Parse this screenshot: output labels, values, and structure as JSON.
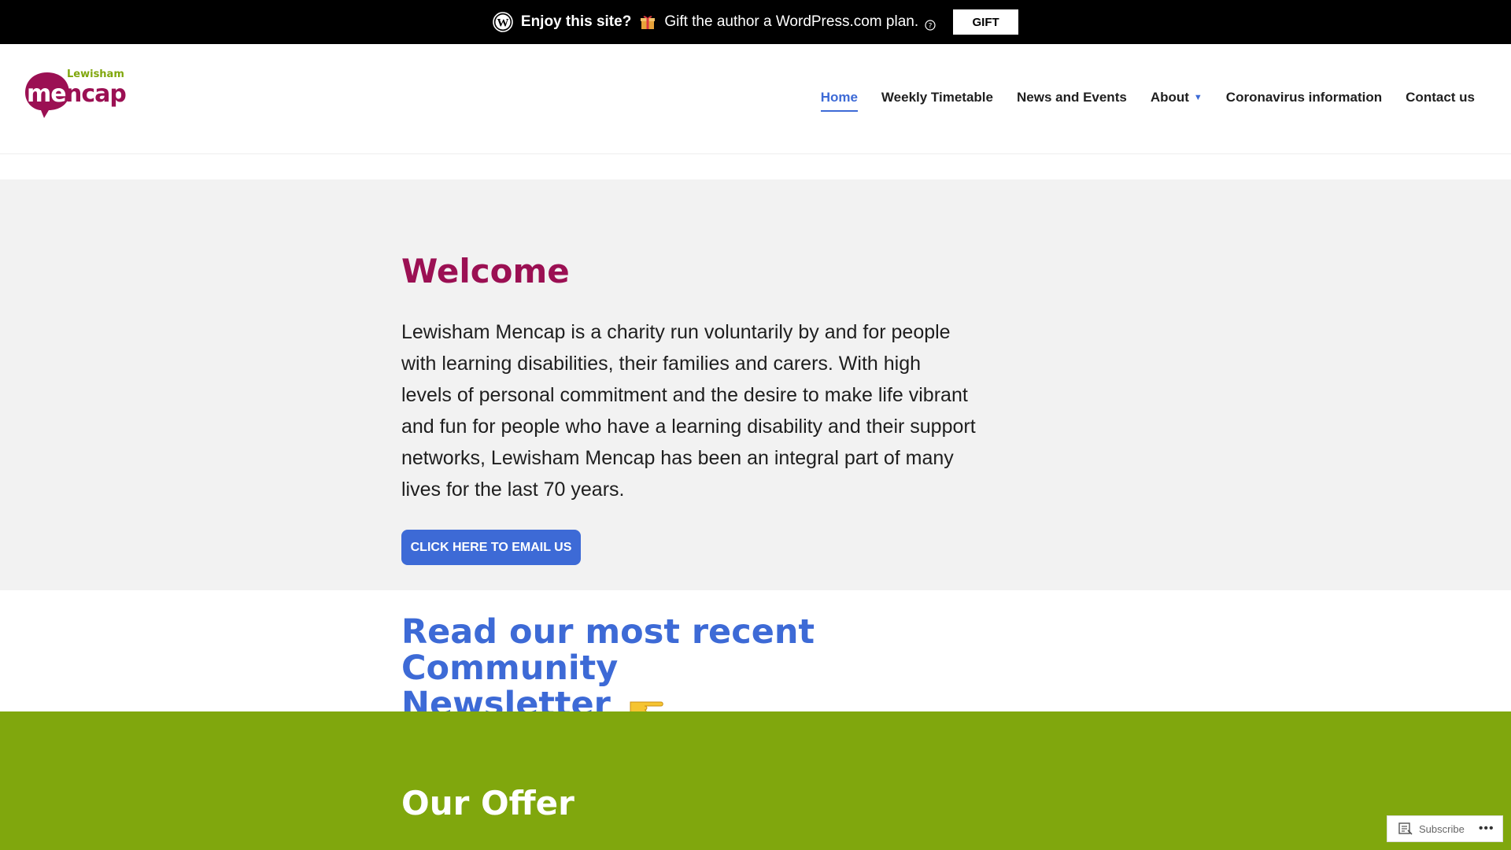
{
  "promo": {
    "enjoy_text": "Enjoy this site?",
    "message": "Gift the author a WordPress.com plan.",
    "gift_button": "GIFT"
  },
  "logo": {
    "small_text": "Lewisham",
    "main_text": "mencap",
    "brand_color": "#9b1053",
    "accent_color": "#80a70d"
  },
  "nav": {
    "items": [
      {
        "label": "Home",
        "active": true
      },
      {
        "label": "Weekly Timetable"
      },
      {
        "label": "News and Events"
      },
      {
        "label": "About",
        "has_dropdown": true
      },
      {
        "label": "Coronavirus information"
      },
      {
        "label": "Contact us"
      }
    ]
  },
  "welcome": {
    "title": "Welcome",
    "body": "Lewisham Mencap is a charity run voluntarily by and for people with learning disabilities, their families and carers.  With high levels of personal commitment and the desire to make life vibrant and fun for people who have a learning disability and their support networks, Lewisham Mencap has been an integral part of many lives for the last 70 years.",
    "button": "CLICK HERE TO EMAIL US"
  },
  "newsletter": {
    "line1": "Read our most recent Community",
    "line2": "Newsletter"
  },
  "offer": {
    "title": "Our Offer"
  },
  "subscribe": {
    "label": "Subscribe",
    "more": "•••"
  },
  "colors": {
    "primary_blue": "#3d6ad6",
    "welcome_bg": "#f2f2f2",
    "offer_bg": "#80a70d"
  }
}
